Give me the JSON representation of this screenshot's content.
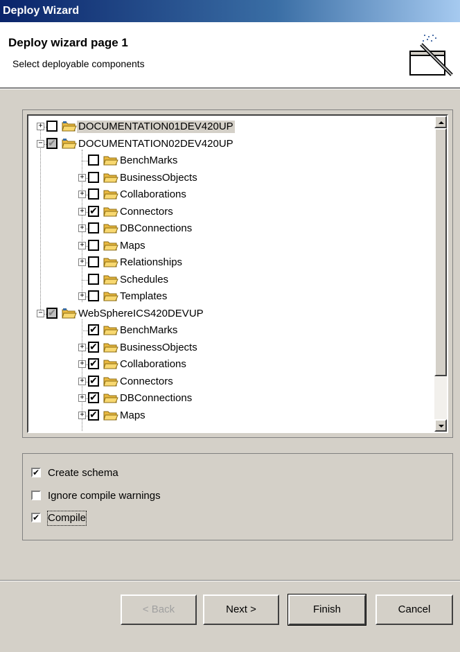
{
  "window": {
    "title": "Deploy Wizard"
  },
  "header": {
    "title": "Deploy wizard page 1",
    "subtitle": "Select deployable components",
    "icon": "wizard-wand-icon"
  },
  "tree": {
    "rows": [
      {
        "label": "DOCUMENTATION01DEV420UP",
        "level": 0,
        "expander": "+",
        "checked": false,
        "grayed": false,
        "selected": true
      },
      {
        "label": "DOCUMENTATION02DEV420UP",
        "level": 0,
        "expander": "-",
        "checked": true,
        "grayed": true,
        "selected": false
      },
      {
        "label": "BenchMarks",
        "level": 1,
        "expander": "",
        "checked": false,
        "grayed": false
      },
      {
        "label": "BusinessObjects",
        "level": 1,
        "expander": "+",
        "checked": false,
        "grayed": false
      },
      {
        "label": "Collaborations",
        "level": 1,
        "expander": "+",
        "checked": false,
        "grayed": false
      },
      {
        "label": "Connectors",
        "level": 1,
        "expander": "+",
        "checked": true,
        "grayed": false
      },
      {
        "label": "DBConnections",
        "level": 1,
        "expander": "+",
        "checked": false,
        "grayed": false
      },
      {
        "label": "Maps",
        "level": 1,
        "expander": "+",
        "checked": false,
        "grayed": false
      },
      {
        "label": "Relationships",
        "level": 1,
        "expander": "+",
        "checked": false,
        "grayed": false
      },
      {
        "label": "Schedules",
        "level": 1,
        "expander": "",
        "checked": false,
        "grayed": false
      },
      {
        "label": "Templates",
        "level": 1,
        "expander": "+",
        "checked": false,
        "grayed": false
      },
      {
        "label": "WebSphereICS420DEVUP",
        "level": 0,
        "expander": "-",
        "checked": true,
        "grayed": true,
        "selected": false
      },
      {
        "label": "BenchMarks",
        "level": 1,
        "expander": "",
        "checked": true,
        "grayed": false
      },
      {
        "label": "BusinessObjects",
        "level": 1,
        "expander": "+",
        "checked": true,
        "grayed": false
      },
      {
        "label": "Collaborations",
        "level": 1,
        "expander": "+",
        "checked": true,
        "grayed": false
      },
      {
        "label": "Connectors",
        "level": 1,
        "expander": "+",
        "checked": true,
        "grayed": false
      },
      {
        "label": "DBConnections",
        "level": 1,
        "expander": "+",
        "checked": true,
        "grayed": false
      },
      {
        "label": "Maps",
        "level": 1,
        "expander": "+",
        "checked": true,
        "grayed": false
      }
    ]
  },
  "options": {
    "create_schema": {
      "label": "Create schema",
      "checked": true
    },
    "ignore_warnings": {
      "label": "Ignore compile warnings",
      "checked": false
    },
    "compile": {
      "label": "Compile",
      "checked": true
    }
  },
  "buttons": {
    "back": "< Back",
    "next": "Next >",
    "finish": "Finish",
    "cancel": "Cancel"
  }
}
